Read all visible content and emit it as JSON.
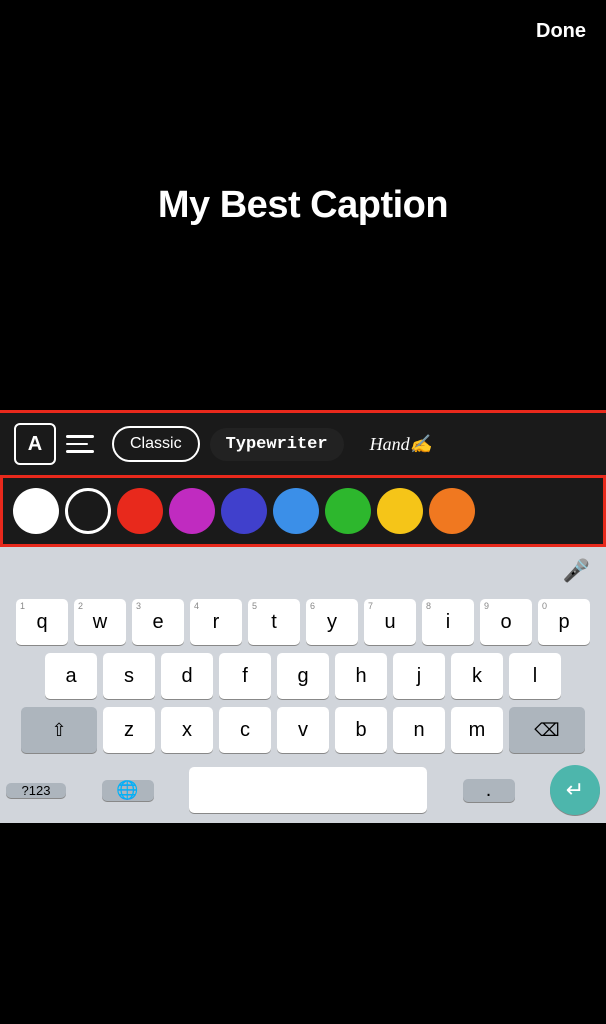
{
  "header": {
    "done_label": "Done"
  },
  "canvas": {
    "caption": "My Best Caption"
  },
  "toolbar": {
    "font_a_label": "A",
    "classic_label": "Classic",
    "typewriter_label": "Typewriter",
    "handwriting_label": "Hand✍"
  },
  "colors": [
    {
      "name": "white-solid",
      "label": "White Solid"
    },
    {
      "name": "white-outline",
      "label": "White Outline"
    },
    {
      "name": "red",
      "label": "Red"
    },
    {
      "name": "purple",
      "label": "Purple"
    },
    {
      "name": "dark-blue",
      "label": "Dark Blue"
    },
    {
      "name": "blue",
      "label": "Blue"
    },
    {
      "name": "green",
      "label": "Green"
    },
    {
      "name": "yellow",
      "label": "Yellow"
    },
    {
      "name": "orange",
      "label": "Orange"
    }
  ],
  "keyboard": {
    "rows": [
      [
        "q",
        "w",
        "e",
        "r",
        "t",
        "y",
        "u",
        "i",
        "o",
        "p"
      ],
      [
        "a",
        "s",
        "d",
        "f",
        "g",
        "h",
        "j",
        "k",
        "l"
      ],
      [
        "z",
        "x",
        "c",
        "v",
        "b",
        "n",
        "m"
      ]
    ],
    "num_hints": [
      "1",
      "2",
      "3",
      "4",
      "5",
      "6",
      "7",
      "8",
      "9",
      "0"
    ],
    "sym_label": "?123",
    "space_label": "",
    "period_label": "."
  }
}
